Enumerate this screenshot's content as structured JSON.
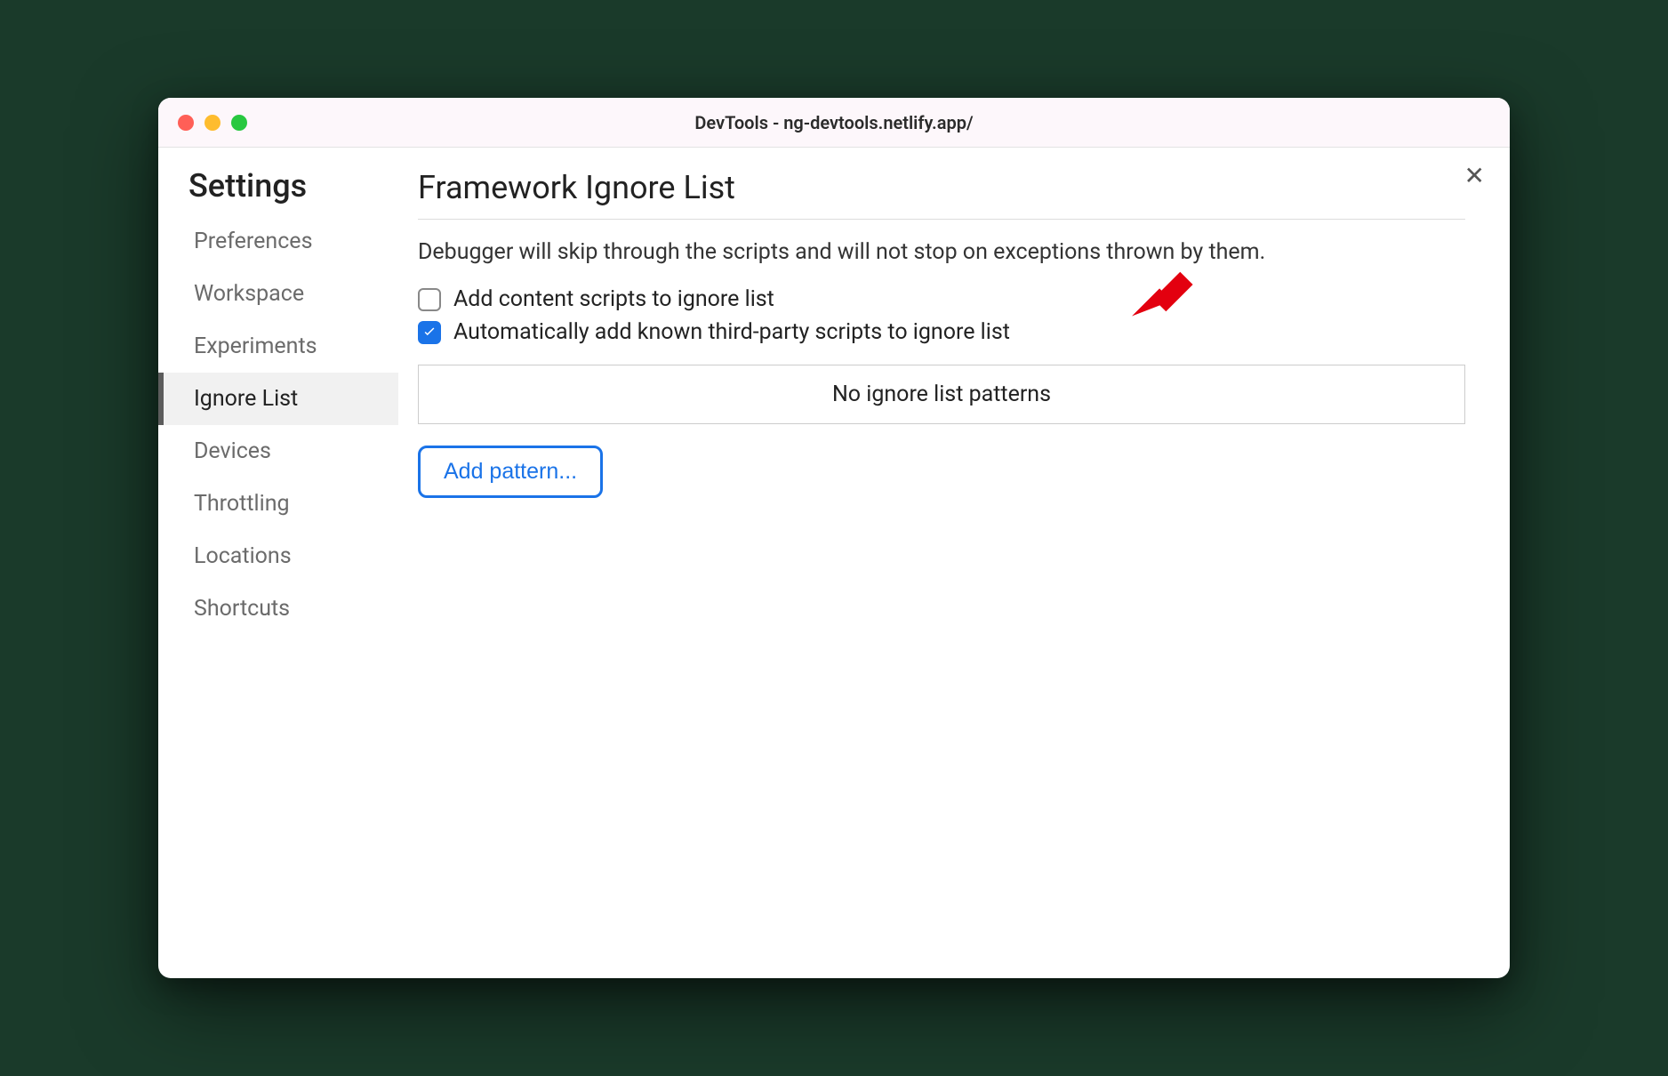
{
  "window": {
    "title": "DevTools - ng-devtools.netlify.app/"
  },
  "sidebar": {
    "heading": "Settings",
    "items": [
      {
        "label": "Preferences",
        "active": false
      },
      {
        "label": "Workspace",
        "active": false
      },
      {
        "label": "Experiments",
        "active": false
      },
      {
        "label": "Ignore List",
        "active": true
      },
      {
        "label": "Devices",
        "active": false
      },
      {
        "label": "Throttling",
        "active": false
      },
      {
        "label": "Locations",
        "active": false
      },
      {
        "label": "Shortcuts",
        "active": false
      }
    ]
  },
  "main": {
    "heading": "Framework Ignore List",
    "description": "Debugger will skip through the scripts and will not stop on exceptions thrown by them.",
    "options": [
      {
        "label": "Add content scripts to ignore list",
        "checked": false
      },
      {
        "label": "Automatically add known third-party scripts to ignore list",
        "checked": true
      }
    ],
    "patterns_empty": "No ignore list patterns",
    "add_button": "Add pattern..."
  },
  "annotation": {
    "arrow_color": "#e3000f"
  }
}
